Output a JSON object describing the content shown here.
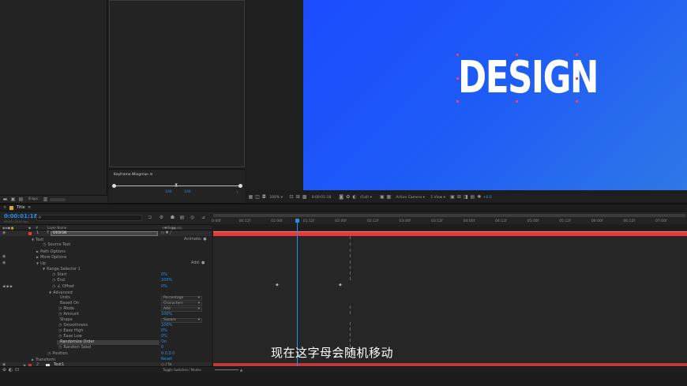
{
  "project_panel": {
    "footer": {
      "bpc": "8 bpc"
    }
  },
  "wiggle_panel": {
    "title": "Keyframe Wiegman",
    "left_value": "100",
    "right_value": "100"
  },
  "viewer": {
    "main_text": "DESIGN",
    "bg_color_top": "#1b50ff",
    "bg_color_bottom": "#2f74e6",
    "toolbar": {
      "zoom": "100%",
      "timecode": "0:00:01:18",
      "resolution": "(Full)",
      "camera": "Active Camera",
      "views": "1 View",
      "exposure": "+0.0"
    }
  },
  "comp": {
    "tab_label": "Title",
    "timecode": "0:00:01:18",
    "frame_info": "00043 (25.00 fps)",
    "search_placeholder": "ρ.",
    "column_header": "Layer Name",
    "footer_label": "Toggle Switches / Modes"
  },
  "layers": {
    "layer1": {
      "num": "1",
      "name": "DESIGN",
      "animate": "Animate:"
    },
    "text": "Text",
    "source_text": "Source Text",
    "path_options": "Path Options",
    "more_options": "More Options",
    "up": "Up",
    "add": "Add:",
    "range_selector": "Range Selector 1",
    "start": {
      "label": "Start",
      "value": "0%"
    },
    "end": {
      "label": "End",
      "value": "100%"
    },
    "offset": {
      "label": "Offset",
      "value": "0%"
    },
    "advanced": "Advanced",
    "units": {
      "label": "Units",
      "value": "Percentage"
    },
    "based_on": {
      "label": "Based On",
      "value": "Characters"
    },
    "mode": {
      "label": "Mode",
      "value": "Add"
    },
    "amount": {
      "label": "Amount",
      "value": "100%"
    },
    "shape": {
      "label": "Shape",
      "value": "Square"
    },
    "smoothness": {
      "label": "Smoothness",
      "value": "100%"
    },
    "ease_high": {
      "label": "Ease High",
      "value": "0%"
    },
    "ease_low": {
      "label": "Ease Low",
      "value": "0%"
    },
    "randomize_order": {
      "label": "Randomize Order",
      "value": "On"
    },
    "random_seed": {
      "label": "Random Seed",
      "value": "0"
    },
    "position": {
      "label": "Position",
      "value": "0.0,0.0"
    },
    "transform": {
      "label": "Transform",
      "value": "Reset"
    },
    "layer2": {
      "num": "2",
      "name": "Text1"
    }
  },
  "timeline": {
    "ticks": [
      "0:00f",
      "00:12f",
      "01:00f",
      "01:12f",
      "02:00f",
      "02:12f",
      "03:00f",
      "03:12f",
      "04:00f",
      "04:12f",
      "05:00f",
      "05:12f",
      "06:00f",
      "06:12f",
      "07:00f"
    ],
    "layer1_color": "#e5393c",
    "layer2_color": "#c0393b",
    "playhead_fraction": 0.176
  },
  "subtitle": "现在这字母会随机移动"
}
